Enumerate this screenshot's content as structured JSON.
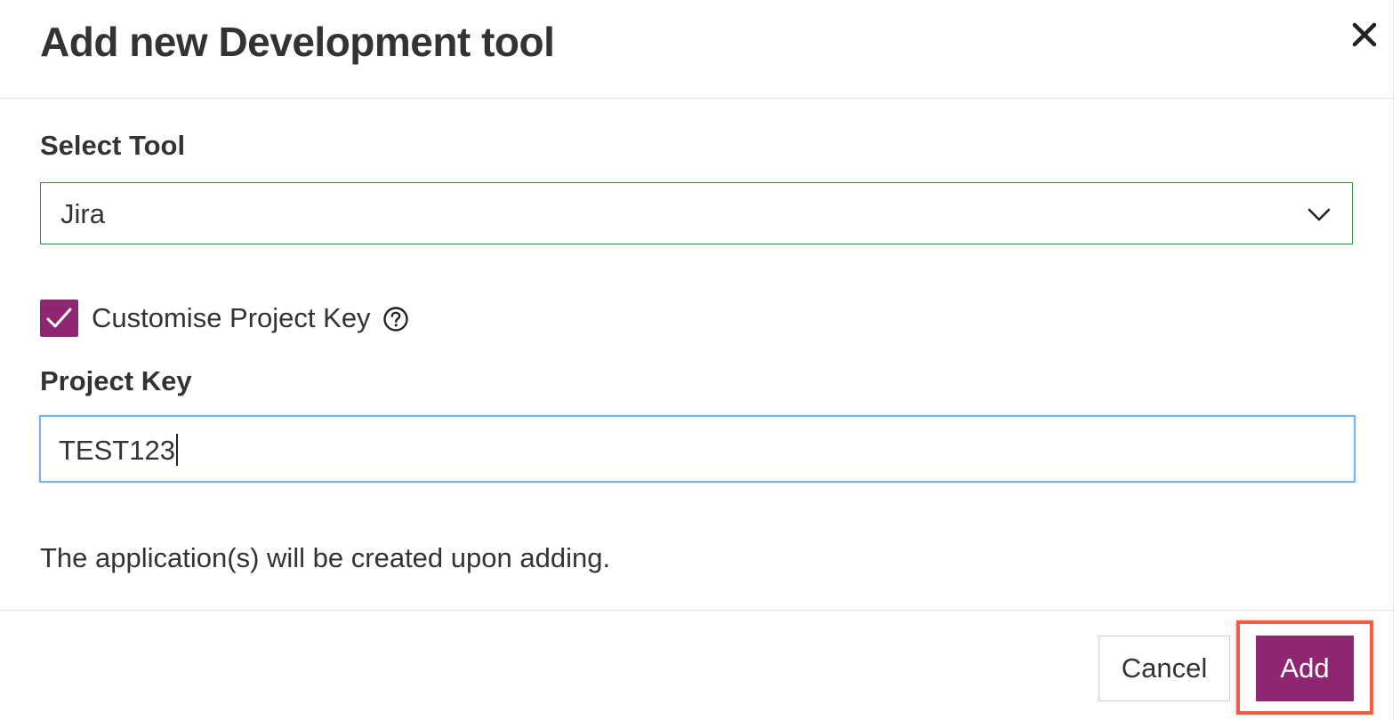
{
  "dialog": {
    "title": "Add new Development tool",
    "close_icon": "close-icon"
  },
  "tool_select": {
    "label": "Select Tool",
    "value": "Jira",
    "icon": "chevron-down-icon"
  },
  "customise_key": {
    "checked": true,
    "label": "Customise Project Key",
    "help_icon": "question-circle-icon"
  },
  "project_key": {
    "label": "Project Key",
    "value": "TEST123"
  },
  "info_text": "The application(s) will be created upon adding.",
  "footer": {
    "cancel_label": "Cancel",
    "add_label": "Add"
  },
  "colors": {
    "accent": "#8e2672",
    "select_border": "#2e8b3a",
    "input_focus_border": "#7ab3e8",
    "highlight": "#ef5f48"
  }
}
